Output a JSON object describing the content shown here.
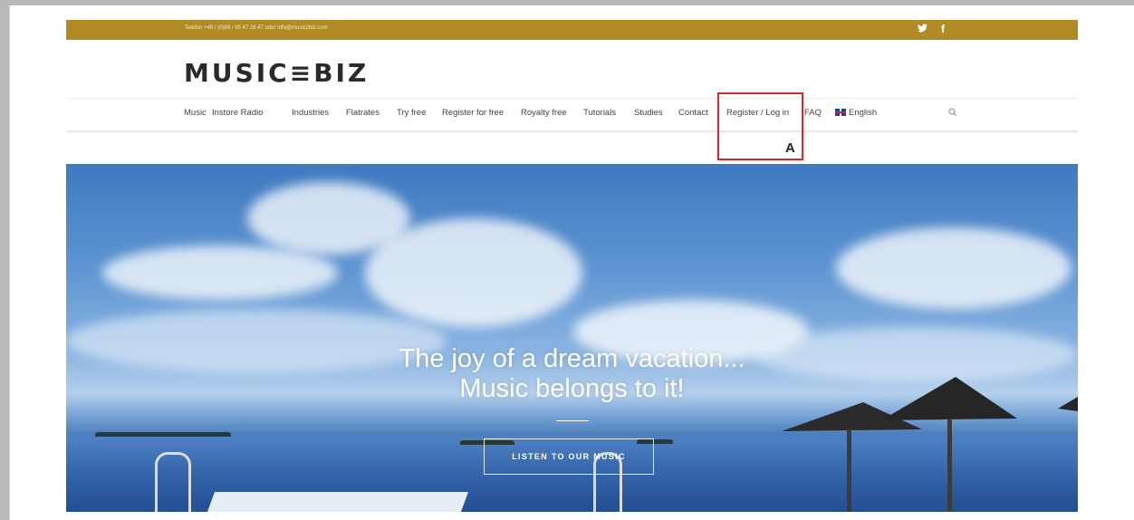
{
  "topbar": {
    "contact": "Telefon +49 / (0)69 / 95 47 28 47 oder info@music2biz.com",
    "social": [
      {
        "name": "twitter",
        "glyph": "✈"
      },
      {
        "name": "facebook",
        "glyph": "f"
      }
    ],
    "background": "#b08a25"
  },
  "logo": {
    "text": "MUSIC≡BIZ"
  },
  "nav": {
    "items": [
      {
        "label": "Music"
      },
      {
        "label": "Instore Radio"
      },
      {
        "label": "Industries"
      },
      {
        "label": "Flatrates"
      },
      {
        "label": "Try free"
      },
      {
        "label": "Register for free"
      },
      {
        "label": "Royalty free"
      },
      {
        "label": "Tutorials"
      },
      {
        "label": "Studies"
      },
      {
        "label": "Contact"
      },
      {
        "label": "Register / Log in"
      },
      {
        "label": "FAQ"
      }
    ],
    "language": "English",
    "search_icon": "search-icon"
  },
  "annotation": {
    "label": "A",
    "color": "#d8262c"
  },
  "hero": {
    "headline_line1": "The joy of a dream vacation...",
    "headline_line2": "Music belongs to it!",
    "cta_label": "LISTEN TO OUR MUSIC"
  }
}
